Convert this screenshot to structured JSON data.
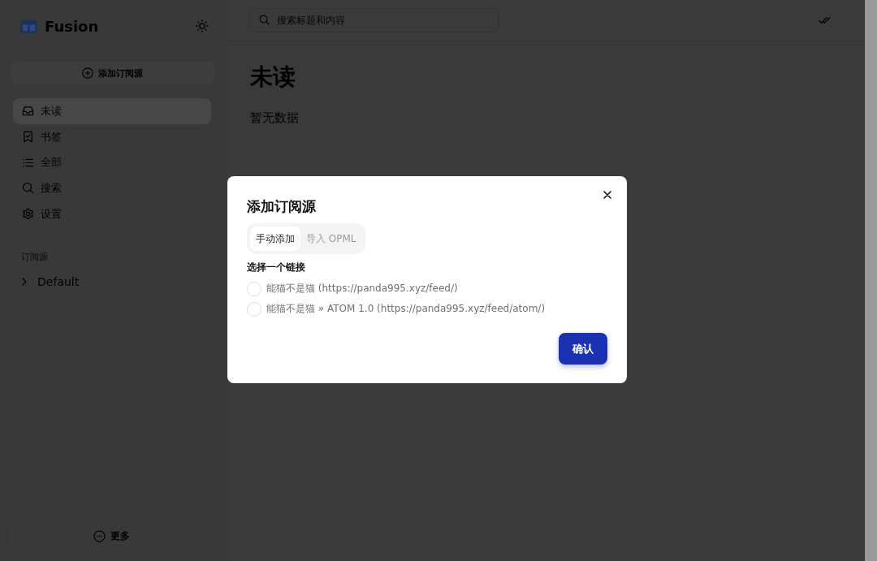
{
  "sidebar": {
    "app_name": "Fusion",
    "add_feed_button": "添加订阅源",
    "nav_items": [
      {
        "label": "未读",
        "selected": true
      },
      {
        "label": "书签",
        "selected": false
      },
      {
        "label": "全部",
        "selected": false
      },
      {
        "label": "搜索",
        "selected": false
      },
      {
        "label": "设置",
        "selected": false
      }
    ],
    "section_title": "订阅源",
    "feed_groups": [
      {
        "label": "Default",
        "expanded": false
      }
    ],
    "more_button": "更多"
  },
  "header": {
    "search": {
      "placeholder": "搜索标题和内容"
    }
  },
  "main": {
    "title": "未读",
    "empty_text": "暂无数据"
  },
  "dialog": {
    "title": "添加订阅源",
    "tabs": [
      {
        "label": "手动添加",
        "selected": true
      },
      {
        "label": "导入 OPML",
        "selected": false
      }
    ],
    "field_label": "选择一个链接",
    "options": [
      {
        "label": "能猫不是猫 (https://panda995.xyz/feed/)",
        "selected": false
      },
      {
        "label": "能猫不是猫 » ATOM 1.0 (https://panda995.xyz/feed/atom/)",
        "selected": false
      }
    ],
    "confirm_button": "确认"
  }
}
